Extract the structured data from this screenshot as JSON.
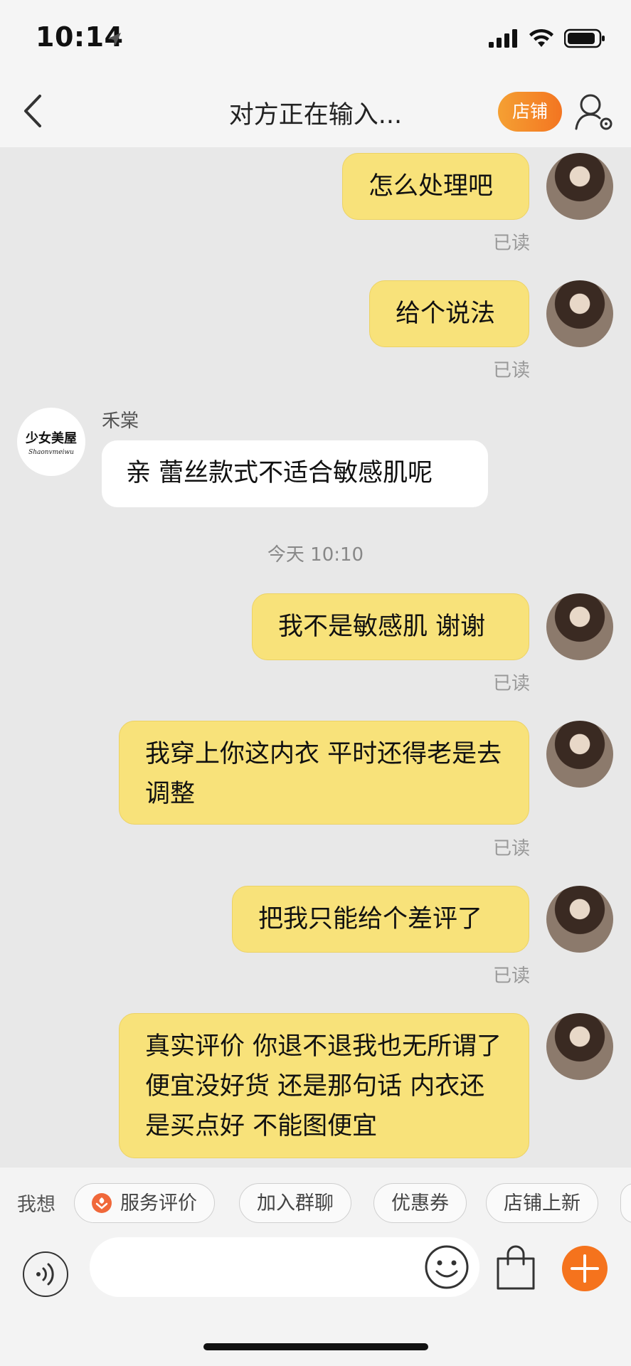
{
  "status_bar": {
    "time": "10:14"
  },
  "header": {
    "title": "对方正在输入...",
    "shop_label": "店铺"
  },
  "shop_logo": {
    "cn": "少女美屋",
    "en": "Shaonvmeiwu"
  },
  "messages": [
    {
      "from": "me",
      "text": "怎么处理吧",
      "receipt": "已读"
    },
    {
      "from": "me",
      "text": "给个说法",
      "receipt": "已读"
    },
    {
      "from": "shop",
      "sender": "禾棠",
      "text": "亲 蕾丝款式不适合敏感肌呢"
    },
    {
      "type": "time",
      "text": "今天 10:10"
    },
    {
      "from": "me",
      "text": "我不是敏感肌 谢谢",
      "receipt": "已读"
    },
    {
      "from": "me",
      "text": "我穿上你这内衣 平时还得老是去调整",
      "receipt": "已读"
    },
    {
      "from": "me",
      "text": "把我只能给个差评了",
      "receipt": "已读"
    },
    {
      "from": "me",
      "text": "真实评价 你退不退我也无所谓了 便宜没好货 还是那句话 内衣还是买点好 不能图便宜"
    }
  ],
  "quick_bar": {
    "label": "我想",
    "chips": [
      "服务评价",
      "加入群聊",
      "优惠券",
      "店铺上新"
    ]
  },
  "input": {
    "placeholder": ""
  },
  "colors": {
    "accent": "#f5731d",
    "my_bubble": "#f8e27a",
    "their_bubble": "#ffffff",
    "background": "#e8e8e8"
  }
}
